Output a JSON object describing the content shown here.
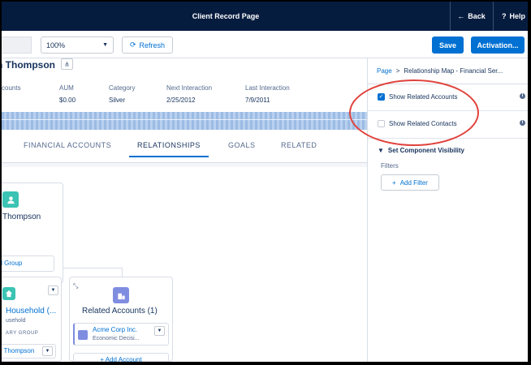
{
  "topbar": {
    "title": "Client Record Page",
    "back_label": "Back",
    "help_label": "Help"
  },
  "toolbar": {
    "zoom_value": "100%",
    "refresh_label": "Refresh",
    "save_label": "Save",
    "activation_label": "Activation..."
  },
  "record": {
    "name": "n Thompson",
    "fields": [
      {
        "label": "ccounts",
        "value": ""
      },
      {
        "label": "AUM",
        "value": "$0.00"
      },
      {
        "label": "Category",
        "value": "Silver"
      },
      {
        "label": "Next Interaction",
        "value": "2/25/2012"
      },
      {
        "label": "Last Interaction",
        "value": "7/9/2011"
      }
    ],
    "tabs": [
      {
        "label": "FINANCIAL ACCOUNTS",
        "active": false
      },
      {
        "label": "RELATIONSHIPS",
        "active": true
      },
      {
        "label": "GOALS",
        "active": false
      },
      {
        "label": "RELATED",
        "active": false
      }
    ]
  },
  "graph": {
    "person_name": "Thompson",
    "add_group_label": "dd Group",
    "household_name": "Household (...",
    "household_sub": "usehold",
    "group_tag": "ARY GROUP",
    "member_name": "n Thompson",
    "related_accounts_title": "Related Accounts (1)",
    "account_name": "Acme Corp Inc.",
    "account_sub": "Economic Decisi...",
    "add_account_label": "+ Add Account"
  },
  "panel": {
    "crumb_page": "Page",
    "crumb_sep": ">",
    "crumb_current": "Relationship Map - Financial Ser...",
    "show_related_accounts": "Show Related Accounts",
    "show_related_contacts": "Show Related Contacts",
    "section_title": "Set Component Visibility",
    "filters_label": "Filters",
    "add_filter_label": "Add Filter"
  },
  "colors": {
    "brand": "#0070d2",
    "topbar": "#061c3f",
    "highlight": "#e0423c"
  }
}
